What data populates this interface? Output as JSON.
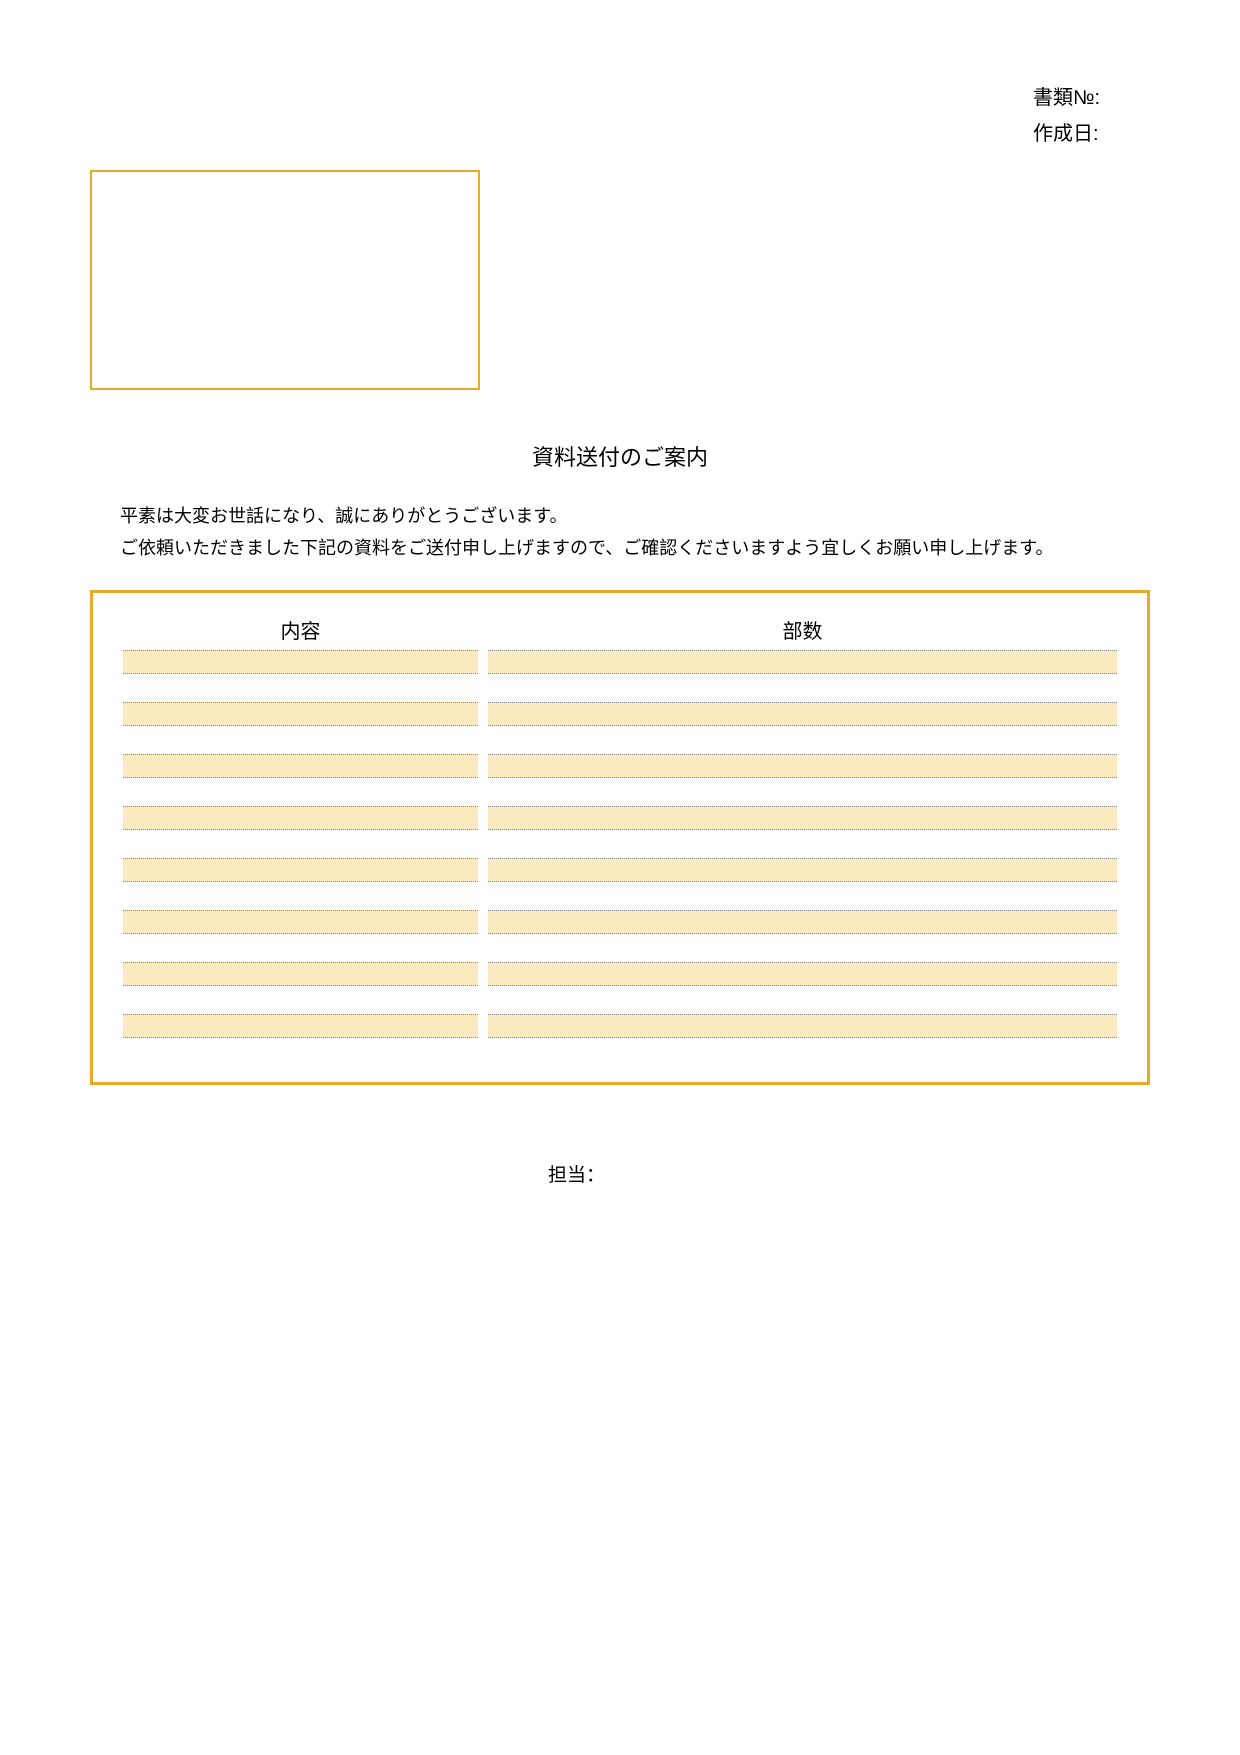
{
  "meta": {
    "document_no_label": "書類№:",
    "created_date_label": "作成日:"
  },
  "title": "資料送付のご案内",
  "body": {
    "line1": "平素は大変お世話になり、誠にありがとうございます。",
    "line2": "ご依頼いただきました下記の資料をご送付申し上げますので、ご確認くださいますよう宜しくお願い申し上げます。"
  },
  "table": {
    "header_content": "内容",
    "header_copies": "部数",
    "rows": [
      {
        "content": "",
        "copies": ""
      },
      {
        "content": "",
        "copies": ""
      },
      {
        "content": "",
        "copies": ""
      },
      {
        "content": "",
        "copies": ""
      },
      {
        "content": "",
        "copies": ""
      },
      {
        "content": "",
        "copies": ""
      },
      {
        "content": "",
        "copies": ""
      },
      {
        "content": "",
        "copies": ""
      }
    ]
  },
  "person_in_charge_label": "担当："
}
